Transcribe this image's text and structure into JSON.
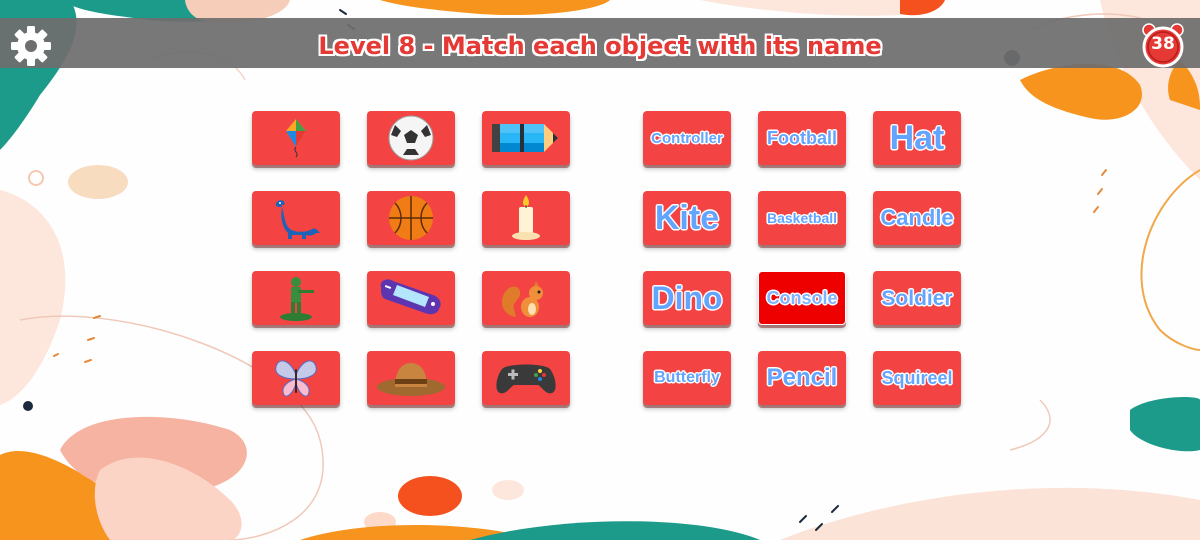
{
  "header": {
    "title": "Level 8 - Match each object with its name",
    "timer_value": "38"
  },
  "colors": {
    "tile": "#f44343",
    "selected_tile": "#ee0000",
    "word_text": "#63a4ff",
    "title_text": "#e53935",
    "bar": "#6e6e6e"
  },
  "picture_tiles": [
    {
      "icon": "kite-icon"
    },
    {
      "icon": "soccer-ball-icon"
    },
    {
      "icon": "pencil-icon"
    },
    {
      "icon": "dinosaur-icon"
    },
    {
      "icon": "basketball-icon"
    },
    {
      "icon": "candle-icon"
    },
    {
      "icon": "toy-soldier-icon"
    },
    {
      "icon": "handheld-console-icon"
    },
    {
      "icon": "squirrel-icon"
    },
    {
      "icon": "butterfly-icon"
    },
    {
      "icon": "hat-icon"
    },
    {
      "icon": "game-controller-icon"
    }
  ],
  "word_tiles": [
    {
      "label": "Controller",
      "selected": false
    },
    {
      "label": "Football",
      "selected": false
    },
    {
      "label": "Hat",
      "selected": false
    },
    {
      "label": "Kite",
      "selected": false
    },
    {
      "label": "Basketball",
      "selected": false
    },
    {
      "label": "Candle",
      "selected": false
    },
    {
      "label": "Dino",
      "selected": false
    },
    {
      "label": "Console",
      "selected": true
    },
    {
      "label": "Soldier",
      "selected": false
    },
    {
      "label": "Butterfly",
      "selected": false
    },
    {
      "label": "Pencil",
      "selected": false
    },
    {
      "label": "Squireel",
      "selected": false
    }
  ]
}
